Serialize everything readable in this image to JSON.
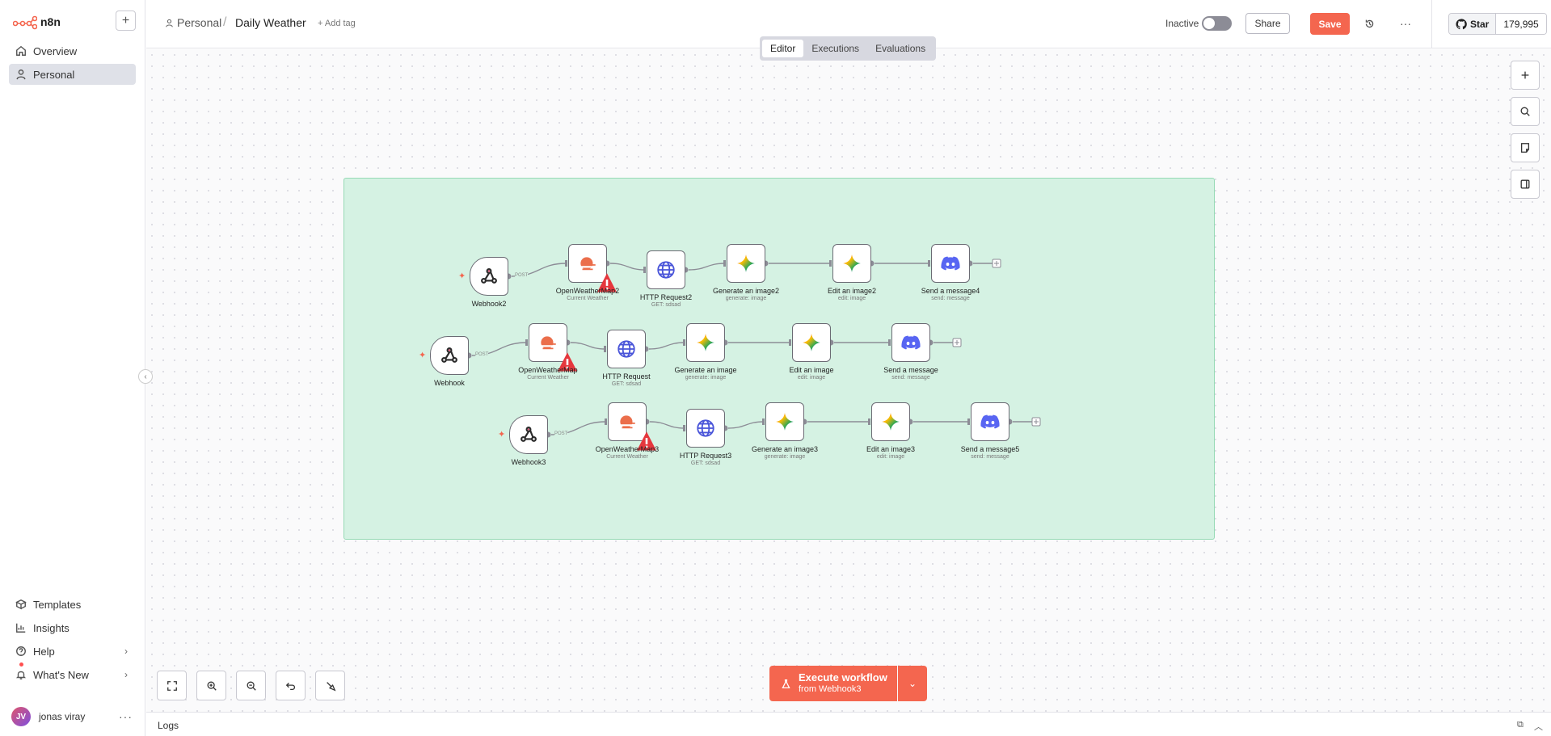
{
  "app": {
    "name": "n8n"
  },
  "sidebar": {
    "items": [
      {
        "label": "Overview",
        "icon": "home-icon"
      },
      {
        "label": "Personal",
        "icon": "user-icon"
      }
    ],
    "bottom_items": [
      {
        "label": "Templates",
        "icon": "box-icon"
      },
      {
        "label": "Insights",
        "icon": "chart-icon"
      },
      {
        "label": "Help",
        "icon": "help-icon"
      },
      {
        "label": "What's New",
        "icon": "bell-icon"
      }
    ],
    "user": {
      "initials": "JV",
      "name": "jonas viray"
    }
  },
  "header": {
    "project": "Personal",
    "workflow_title": "Daily Weather",
    "add_tag": "+ Add tag",
    "status_label": "Inactive",
    "share_label": "Share",
    "save_label": "Save",
    "github": {
      "star_label": "Star",
      "count": "179,995"
    }
  },
  "tabs": [
    {
      "label": "Editor",
      "active": true
    },
    {
      "label": "Executions",
      "active": false
    },
    {
      "label": "Evaluations",
      "active": false
    }
  ],
  "workflow": {
    "rows": [
      {
        "trigger": {
          "label": "Webhook2",
          "method": "POST"
        },
        "nodes": [
          {
            "label": "OpenWeatherMap2",
            "sub": "Current Weather",
            "type": "weather",
            "warning": true
          },
          {
            "label": "HTTP Request2",
            "sub": "GET: sdsad",
            "type": "http"
          },
          {
            "label": "Generate an image2",
            "sub": "generate: image",
            "type": "gemini"
          },
          {
            "label": "Edit an image2",
            "sub": "edit: image",
            "type": "gemini"
          },
          {
            "label": "Send a message4",
            "sub": "send: message",
            "type": "discord"
          }
        ]
      },
      {
        "trigger": {
          "label": "Webhook",
          "method": "POST"
        },
        "nodes": [
          {
            "label": "OpenWeatherMap",
            "sub": "Current Weather",
            "type": "weather",
            "warning": true
          },
          {
            "label": "HTTP Request",
            "sub": "GET: sdsad",
            "type": "http"
          },
          {
            "label": "Generate an image",
            "sub": "generate: image",
            "type": "gemini"
          },
          {
            "label": "Edit an image",
            "sub": "edit: image",
            "type": "gemini"
          },
          {
            "label": "Send a message",
            "sub": "send: message",
            "type": "discord"
          }
        ]
      },
      {
        "trigger": {
          "label": "Webhook3",
          "method": "POST"
        },
        "nodes": [
          {
            "label": "OpenWeatherMap3",
            "sub": "Current Weather",
            "type": "weather",
            "warning": true
          },
          {
            "label": "HTTP Request3",
            "sub": "GET: sdsad",
            "type": "http"
          },
          {
            "label": "Generate an image3",
            "sub": "generate: image",
            "type": "gemini"
          },
          {
            "label": "Edit an image3",
            "sub": "edit: image",
            "type": "gemini"
          },
          {
            "label": "Send a message5",
            "sub": "send: message",
            "type": "discord"
          }
        ]
      }
    ]
  },
  "execute": {
    "label": "Execute workflow",
    "sub": "from Webhook3"
  },
  "logs": {
    "label": "Logs"
  },
  "colors": {
    "accent": "#f4664f",
    "sticky_bg": "#d5f2e3",
    "sticky_border": "#96dab5",
    "discord": "#5865f2",
    "http": "#4a55d9"
  }
}
